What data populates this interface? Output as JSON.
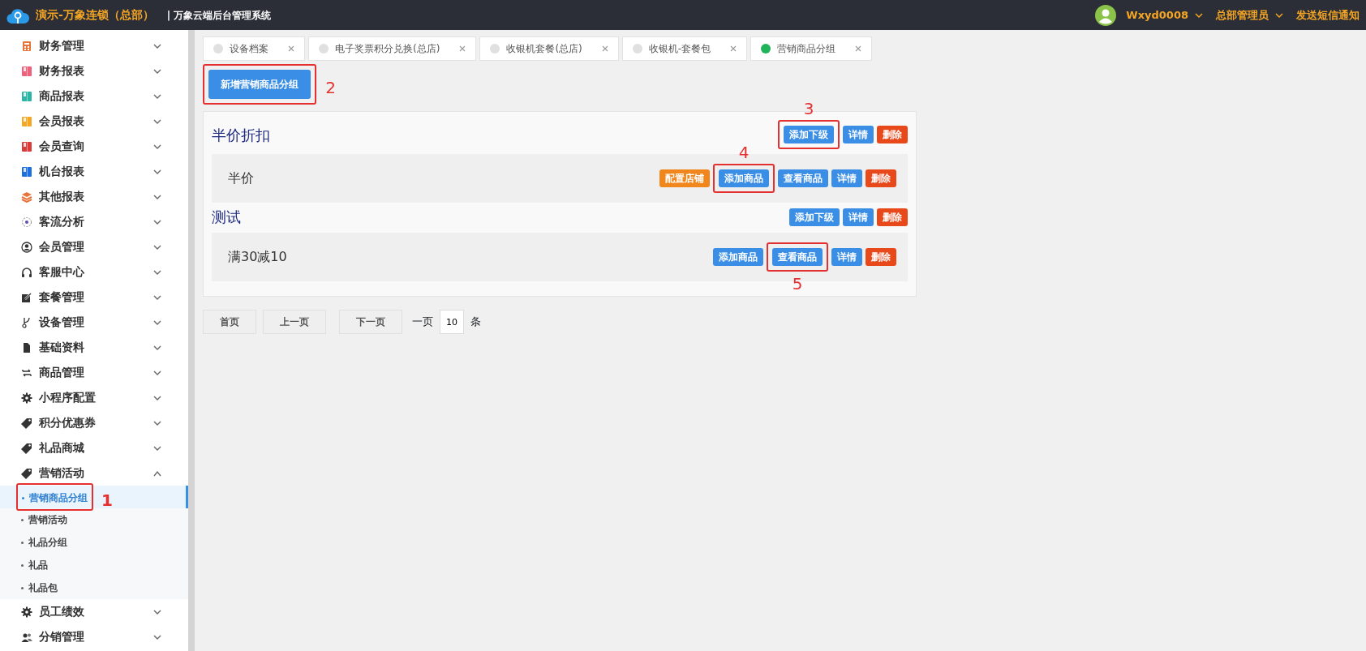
{
  "header": {
    "brand": "演示-万象连锁（总部）",
    "system": "| 万象云端后台管理系统",
    "user": "Wxyd0008",
    "role": "总部管理员",
    "notify": "发送短信通知"
  },
  "sidebar": {
    "items": [
      {
        "label": "财务管理",
        "kind": "calc",
        "color": "#e8743b",
        "expanded": false
      },
      {
        "label": "财务报表",
        "kind": "book",
        "color": "#f0607a",
        "expanded": false
      },
      {
        "label": "商品报表",
        "kind": "book",
        "color": "#2bb5a5",
        "expanded": false
      },
      {
        "label": "会员报表",
        "kind": "book",
        "color": "#f5a623",
        "expanded": false
      },
      {
        "label": "会员查询",
        "kind": "book",
        "color": "#d93a3a",
        "expanded": false
      },
      {
        "label": "机台报表",
        "kind": "book",
        "color": "#1e6fe0",
        "expanded": false
      },
      {
        "label": "其他报表",
        "kind": "layers",
        "color": "#e8743b",
        "expanded": false
      },
      {
        "label": "客流分析",
        "kind": "target",
        "expanded": false
      },
      {
        "label": "会员管理",
        "kind": "user",
        "expanded": false
      },
      {
        "label": "客服中心",
        "kind": "headset",
        "expanded": false
      },
      {
        "label": "套餐管理",
        "kind": "edit",
        "expanded": false
      },
      {
        "label": "设备管理",
        "kind": "branch",
        "expanded": false
      },
      {
        "label": "基础资料",
        "kind": "file",
        "expanded": false
      },
      {
        "label": "商品管理",
        "kind": "swap",
        "expanded": false
      },
      {
        "label": "小程序配置",
        "kind": "gear",
        "expanded": false
      },
      {
        "label": "积分优惠券",
        "kind": "tag",
        "expanded": false
      },
      {
        "label": "礼品商城",
        "kind": "tag",
        "expanded": false
      },
      {
        "label": "营销活动",
        "kind": "tag",
        "expanded": true,
        "children": [
          {
            "label": "营销商品分组",
            "selected": true,
            "callout": "1"
          },
          {
            "label": "营销活动",
            "selected": false
          },
          {
            "label": "礼品分组",
            "selected": false
          },
          {
            "label": "礼品",
            "selected": false
          },
          {
            "label": "礼品包",
            "selected": false
          }
        ]
      },
      {
        "label": "员工绩效",
        "kind": "gear",
        "expanded": false
      },
      {
        "label": "分销管理",
        "kind": "users",
        "expanded": false
      }
    ]
  },
  "tabs": [
    {
      "label": "设备档案",
      "selected": false
    },
    {
      "label": "电子奖票积分兑换(总店)",
      "selected": false
    },
    {
      "label": "收银机套餐(总店)",
      "selected": false
    },
    {
      "label": "收银机-套餐包",
      "selected": false
    },
    {
      "label": "营销商品分组",
      "selected": true
    }
  ],
  "new_button": {
    "label": "新增营销商品分组",
    "callout": "2"
  },
  "groups": [
    {
      "title": "半价折扣",
      "buttons": [
        {
          "label": "添加下级",
          "kind": "primary",
          "callout": "3"
        },
        {
          "label": "详情",
          "kind": "primary"
        },
        {
          "label": "删除",
          "kind": "danger"
        }
      ],
      "children": [
        {
          "name": "半价",
          "buttons": [
            {
              "label": "配置店铺",
              "kind": "warning"
            },
            {
              "label": "添加商品",
              "kind": "primary",
              "callout": "4"
            },
            {
              "label": "查看商品",
              "kind": "primary"
            },
            {
              "label": "详情",
              "kind": "primary"
            },
            {
              "label": "删除",
              "kind": "danger"
            }
          ]
        }
      ]
    },
    {
      "title": "测试",
      "buttons": [
        {
          "label": "添加下级",
          "kind": "primary"
        },
        {
          "label": "详情",
          "kind": "primary"
        },
        {
          "label": "删除",
          "kind": "danger"
        }
      ],
      "children": [
        {
          "name": "满30减10",
          "buttons": [
            {
              "label": "添加商品",
              "kind": "primary"
            },
            {
              "label": "查看商品",
              "kind": "primary",
              "callout": "5"
            },
            {
              "label": "详情",
              "kind": "primary"
            },
            {
              "label": "删除",
              "kind": "danger"
            }
          ]
        }
      ]
    }
  ],
  "pager": {
    "buttons": [
      "首页",
      "上一页",
      "下一页"
    ],
    "per_page_label": "一页",
    "per_page": "10",
    "unit": "条"
  }
}
